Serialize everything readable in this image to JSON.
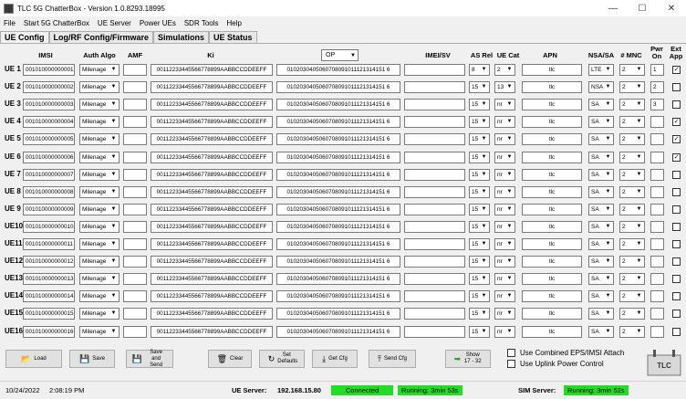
{
  "window": {
    "title": "TLC 5G ChatterBox - Version 1.0.8293.18995",
    "minimize": "—",
    "maximize": "☐",
    "close": "✕"
  },
  "menu": [
    "File",
    "Start 5G ChatterBox",
    "UE Server",
    "Power UEs",
    "SDR Tools",
    "Help"
  ],
  "tabs": [
    "UE Config",
    "Log/RF Config/Firmware",
    "Simulations",
    "UE Status"
  ],
  "headers": {
    "imsi": "IMSI",
    "auth_algo": "Auth Algo",
    "amf": "AMF",
    "ki": "Ki",
    "op_select": "OP",
    "imei_sv": "IMEI/SV",
    "as_rel": "AS Rel",
    "ue_cat": "UE Cat",
    "apn": "APN",
    "nsa_sa": "NSA/SA",
    "mnc": "# MNC",
    "pwr_on": "Pwr On",
    "ext_app": "Ext App"
  },
  "rows": [
    {
      "label": "UE 1",
      "imsi": "001010000000001",
      "auth": "Milenage",
      "amf": "",
      "ki": "00112233445566778899AABBCCDDEEFF",
      "op": "0102030405060708091011121314151 6",
      "imei": "",
      "as_rel": "8",
      "ue_cat": "2",
      "apn": "tlc",
      "nsa": "LTE",
      "mnc": "2",
      "pwr": "1",
      "ext": true
    },
    {
      "label": "UE 2",
      "imsi": "001010000000002",
      "auth": "Milenage",
      "amf": "",
      "ki": "00112233445566778899AABBCCDDEEFF",
      "op": "0102030405060708091011121314151 6",
      "imei": "",
      "as_rel": "15",
      "ue_cat": "13",
      "apn": "tlc",
      "nsa": "NSA",
      "mnc": "2",
      "pwr": "2",
      "ext": false
    },
    {
      "label": "UE 3",
      "imsi": "001010000000003",
      "auth": "Milenage",
      "amf": "",
      "ki": "00112233445566778899AABBCCDDEEFF",
      "op": "0102030405060708091011121314151 6",
      "imei": "",
      "as_rel": "15",
      "ue_cat": "nr",
      "apn": "tlc",
      "nsa": "SA",
      "mnc": "2",
      "pwr": "3",
      "ext": false
    },
    {
      "label": "UE 4",
      "imsi": "001010000000004",
      "auth": "Milenage",
      "amf": "",
      "ki": "00112233445566778899AABBCCDDEEFF",
      "op": "0102030405060708091011121314151 6",
      "imei": "",
      "as_rel": "15",
      "ue_cat": "nr",
      "apn": "tlc",
      "nsa": "SA",
      "mnc": "2",
      "pwr": "",
      "ext": true
    },
    {
      "label": "UE 5",
      "imsi": "001010000000005",
      "auth": "Milenage",
      "amf": "",
      "ki": "00112233445566778899AABBCCDDEEFF",
      "op": "0102030405060708091011121314151 6",
      "imei": "",
      "as_rel": "15",
      "ue_cat": "nr",
      "apn": "tlc",
      "nsa": "SA",
      "mnc": "2",
      "pwr": "",
      "ext": true
    },
    {
      "label": "UE 6",
      "imsi": "001010000000006",
      "auth": "Milenage",
      "amf": "",
      "ki": "00112233445566778899AABBCCDDEEFF",
      "op": "0102030405060708091011121314151 6",
      "imei": "",
      "as_rel": "15",
      "ue_cat": "nr",
      "apn": "tlc",
      "nsa": "SA",
      "mnc": "2",
      "pwr": "",
      "ext": true
    },
    {
      "label": "UE 7",
      "imsi": "001010000000007",
      "auth": "Milenage",
      "amf": "",
      "ki": "00112233445566778899AABBCCDDEEFF",
      "op": "0102030405060708091011121314151 6",
      "imei": "",
      "as_rel": "15",
      "ue_cat": "nr",
      "apn": "tlc",
      "nsa": "SA",
      "mnc": "2",
      "pwr": "",
      "ext": false
    },
    {
      "label": "UE 8",
      "imsi": "001010000000008",
      "auth": "Milenage",
      "amf": "",
      "ki": "00112233445566778899AABBCCDDEEFF",
      "op": "0102030405060708091011121314151 6",
      "imei": "",
      "as_rel": "15",
      "ue_cat": "nr",
      "apn": "tlc",
      "nsa": "SA",
      "mnc": "2",
      "pwr": "",
      "ext": false
    },
    {
      "label": "UE 9",
      "imsi": "001010000000009",
      "auth": "Milenage",
      "amf": "",
      "ki": "00112233445566778899AABBCCDDEEFF",
      "op": "0102030405060708091011121314151 6",
      "imei": "",
      "as_rel": "15",
      "ue_cat": "nr",
      "apn": "tlc",
      "nsa": "SA",
      "mnc": "2",
      "pwr": "",
      "ext": false
    },
    {
      "label": "UE10",
      "imsi": "001010000000010",
      "auth": "Milenage",
      "amf": "",
      "ki": "00112233445566778899AABBCCDDEEFF",
      "op": "0102030405060708091011121314151 6",
      "imei": "",
      "as_rel": "15",
      "ue_cat": "nr",
      "apn": "tlc",
      "nsa": "SA",
      "mnc": "2",
      "pwr": "",
      "ext": false
    },
    {
      "label": "UE11",
      "imsi": "001010000000011",
      "auth": "Milenage",
      "amf": "",
      "ki": "00112233445566778899AABBCCDDEEFF",
      "op": "0102030405060708091011121314151 6",
      "imei": "",
      "as_rel": "15",
      "ue_cat": "nr",
      "apn": "tlc",
      "nsa": "SA",
      "mnc": "2",
      "pwr": "",
      "ext": false
    },
    {
      "label": "UE12",
      "imsi": "001010000000012",
      "auth": "Milenage",
      "amf": "",
      "ki": "00112233445566778899AABBCCDDEEFF",
      "op": "0102030405060708091011121314151 6",
      "imei": "",
      "as_rel": "15",
      "ue_cat": "nr",
      "apn": "tlc",
      "nsa": "SA",
      "mnc": "2",
      "pwr": "",
      "ext": false
    },
    {
      "label": "UE13",
      "imsi": "001010000000013",
      "auth": "Milenage",
      "amf": "",
      "ki": "00112233445566778899AABBCCDDEEFF",
      "op": "0102030405060708091011121314151 6",
      "imei": "",
      "as_rel": "15",
      "ue_cat": "nr",
      "apn": "tlc",
      "nsa": "SA",
      "mnc": "2",
      "pwr": "",
      "ext": false
    },
    {
      "label": "UE14",
      "imsi": "001010000000014",
      "auth": "Milenage",
      "amf": "",
      "ki": "00112233445566778899AABBCCDDEEFF",
      "op": "0102030405060708091011121314151 6",
      "imei": "",
      "as_rel": "15",
      "ue_cat": "nr",
      "apn": "tlc",
      "nsa": "SA",
      "mnc": "2",
      "pwr": "",
      "ext": false
    },
    {
      "label": "UE15",
      "imsi": "001010000000015",
      "auth": "Milenage",
      "amf": "",
      "ki": "00112233445566778899AABBCCDDEEFF",
      "op": "0102030405060708091011121314151 6",
      "imei": "",
      "as_rel": "15",
      "ue_cat": "nr",
      "apn": "tlc",
      "nsa": "SA",
      "mnc": "2",
      "pwr": "",
      "ext": false
    },
    {
      "label": "UE16",
      "imsi": "001010000000016",
      "auth": "Milenage",
      "amf": "",
      "ki": "00112233445566778899AABBCCDDEEFF",
      "op": "0102030405060708091011121314151 6",
      "imei": "",
      "as_rel": "15",
      "ue_cat": "nr",
      "apn": "tlc",
      "nsa": "SA",
      "mnc": "2",
      "pwr": "",
      "ext": false
    }
  ],
  "buttons": {
    "load": "Load",
    "save": "Save",
    "save_and_send": "Save and Send",
    "clear": "Clear",
    "set_defaults": "Set Defaults",
    "get_cfg": "Get Cfg",
    "send_cfg": "Send Cfg",
    "show": "Show 17 - 32"
  },
  "checkboxes": {
    "combined_eps": "Use Combined EPS/IMSI Attach",
    "uplink_power": "Use Uplink Power Control"
  },
  "status": {
    "date": "10/24/2022",
    "time": "2:08:19 PM",
    "ue_server_label": "UE Server:",
    "ue_server_ip": "192.168.15.80",
    "connected": "Connected",
    "ue_running": "Running: 3min 53s",
    "sim_server_label": "SIM Server:",
    "sim_running": "Running: 3min 52s"
  },
  "logo_text": "TLC",
  "colors": {
    "status_green": "#22dd22"
  }
}
